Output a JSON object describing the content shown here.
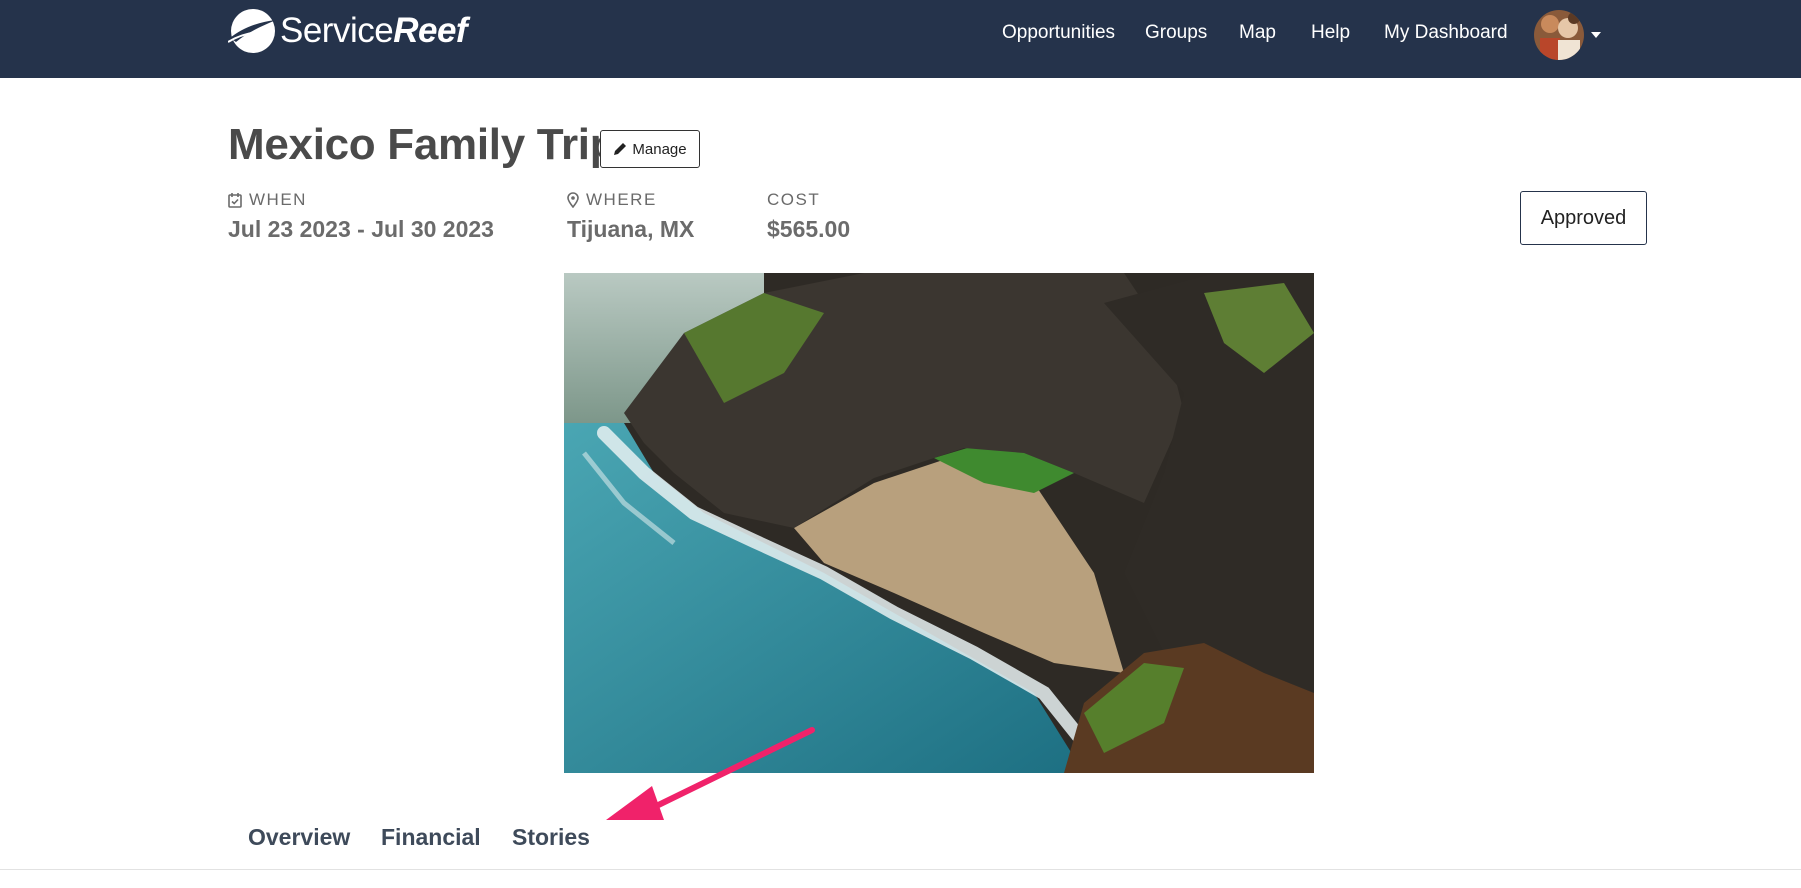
{
  "brand": {
    "name_light": "Service",
    "name_bold": "Reef"
  },
  "nav": {
    "items": [
      {
        "label": "Opportunities"
      },
      {
        "label": "Groups"
      },
      {
        "label": "Map"
      },
      {
        "label": "Help"
      },
      {
        "label": "My Dashboard"
      }
    ],
    "avatar_icon": "user-avatar",
    "dropdown_icon": "caret-down-icon"
  },
  "trip": {
    "title": "Mexico Family Trip",
    "manage_label": "Manage",
    "when_label": "WHEN",
    "when_value": "Jul 23 2023 - Jul 30 2023",
    "where_label": "WHERE",
    "where_value": "Tijuana, MX",
    "cost_label": "COST",
    "cost_value": "$565.00",
    "status": "Approved"
  },
  "tabs": [
    {
      "label": "Overview"
    },
    {
      "label": "Financial"
    },
    {
      "label": "Stories"
    }
  ],
  "colors": {
    "navbar": "#25334b",
    "annotation_arrow": "#f0226a"
  }
}
